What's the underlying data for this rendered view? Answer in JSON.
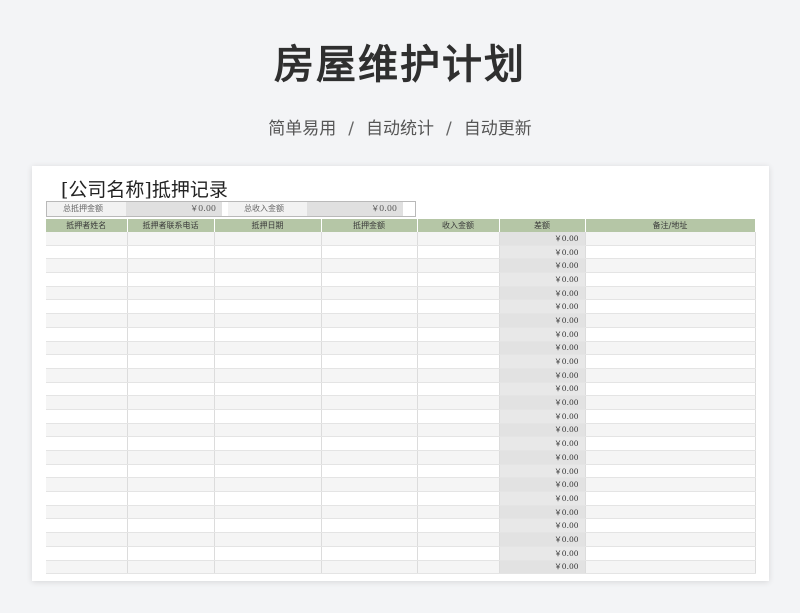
{
  "hero": {
    "title": "房屋维护计划",
    "tags": [
      "简单易用",
      "自动统计",
      "自动更新"
    ],
    "separator": "/"
  },
  "sheet": {
    "company": "[公司名称]抵押记录",
    "summary": [
      {
        "label": "总抵押金额",
        "value": "￥0.00"
      },
      {
        "label": "总收入金额",
        "value": "￥0.00"
      }
    ],
    "columns": [
      "抵押者姓名",
      "抵押者联系电话",
      "抵押日期",
      "抵押金额",
      "收入金额",
      "差额",
      "备注/地址"
    ],
    "rows": [
      {
        "diff": "￥0.00"
      },
      {
        "diff": "￥0.00"
      },
      {
        "diff": "￥0.00"
      },
      {
        "diff": "￥0.00"
      },
      {
        "diff": "￥0.00"
      },
      {
        "diff": "￥0.00"
      },
      {
        "diff": "￥0.00"
      },
      {
        "diff": "￥0.00"
      },
      {
        "diff": "￥0.00"
      },
      {
        "diff": "￥0.00"
      },
      {
        "diff": "￥0.00"
      },
      {
        "diff": "￥0.00"
      },
      {
        "diff": "￥0.00"
      },
      {
        "diff": "￥0.00"
      },
      {
        "diff": "￥0.00"
      },
      {
        "diff": "￥0.00"
      },
      {
        "diff": "￥0.00"
      },
      {
        "diff": "￥0.00"
      },
      {
        "diff": "￥0.00"
      },
      {
        "diff": "￥0.00"
      },
      {
        "diff": "￥0.00"
      },
      {
        "diff": "￥0.00"
      },
      {
        "diff": "￥0.00"
      },
      {
        "diff": "￥0.00"
      },
      {
        "diff": "￥0.00"
      }
    ]
  }
}
